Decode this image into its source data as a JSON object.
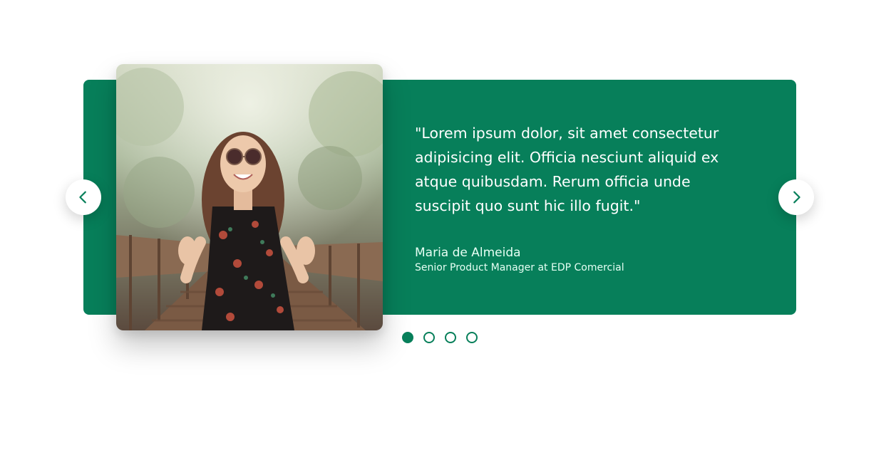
{
  "testimonial": {
    "quote": "\"Lorem ipsum dolor, sit amet consectetur adipisicing elit. Officia nesciunt aliquid ex atque quibusdam. Rerum officia unde suscipit quo sunt hic illo fugit.\"",
    "author_name": "Maria de Almeida",
    "author_role": "Senior Product Manager at EDP Comercial"
  },
  "navigation": {
    "prev_icon": "chevron-left-icon",
    "next_icon": "chevron-right-icon"
  },
  "pagination": {
    "total": 4,
    "active_index": 0
  },
  "colors": {
    "accent": "#077f5a",
    "background": "#ffffff",
    "text_on_accent": "#ffffff"
  }
}
